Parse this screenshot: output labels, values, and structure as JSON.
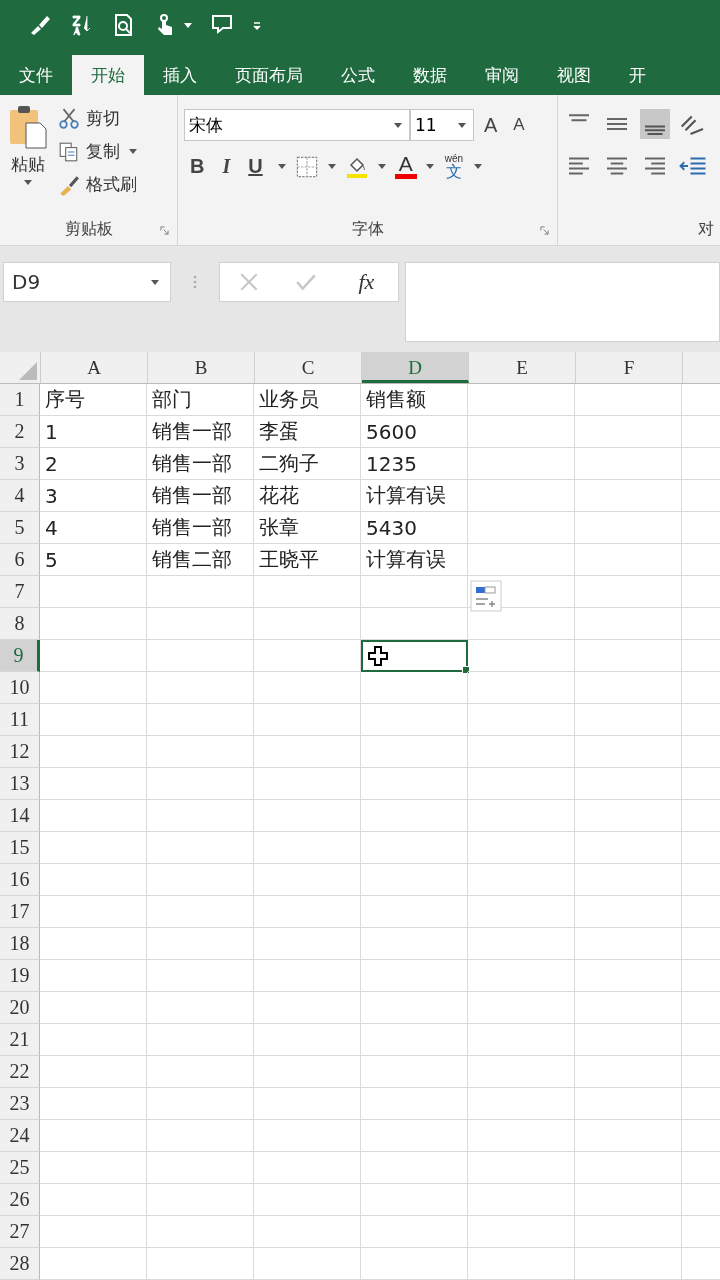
{
  "tabs": [
    {
      "label": "文件",
      "selected": false
    },
    {
      "label": "开始",
      "selected": true
    },
    {
      "label": "插入",
      "selected": false
    },
    {
      "label": "页面布局",
      "selected": false
    },
    {
      "label": "公式",
      "selected": false
    },
    {
      "label": "数据",
      "selected": false
    },
    {
      "label": "审阅",
      "selected": false
    },
    {
      "label": "视图",
      "selected": false
    },
    {
      "label": "开",
      "selected": false
    }
  ],
  "clipboard": {
    "paste": "粘贴",
    "cut": "剪切",
    "copy": "复制",
    "format_painter": "格式刷",
    "label": "剪贴板"
  },
  "font": {
    "name": "宋体",
    "size": "11",
    "grow": "A",
    "shrink": "A",
    "bold": "B",
    "italic": "I",
    "underline": "U",
    "font_color": "A",
    "phonetic_top": "wén",
    "phonetic_bottom": "文",
    "label": "字体"
  },
  "alignment": {
    "label": "对"
  },
  "name_box": "D9",
  "fx": "fx",
  "columns": [
    {
      "label": "A",
      "selected": false
    },
    {
      "label": "B",
      "selected": false
    },
    {
      "label": "C",
      "selected": false
    },
    {
      "label": "D",
      "selected": true
    },
    {
      "label": "E",
      "selected": false
    },
    {
      "label": "F",
      "selected": false
    }
  ],
  "rows": [
    {
      "label": "1",
      "selected": false,
      "cells": [
        "序号",
        "部门",
        "业务员",
        "销售额"
      ]
    },
    {
      "label": "2",
      "selected": false,
      "cells": [
        "1",
        "销售一部",
        "李蛋",
        "5600"
      ]
    },
    {
      "label": "3",
      "selected": false,
      "cells": [
        "2",
        "销售一部",
        "二狗子",
        "1235"
      ]
    },
    {
      "label": "4",
      "selected": false,
      "cells": [
        "3",
        "销售一部",
        "花花",
        "计算有误"
      ]
    },
    {
      "label": "5",
      "selected": false,
      "cells": [
        "4",
        "销售一部",
        "张章",
        "5430"
      ]
    },
    {
      "label": "6",
      "selected": false,
      "cells": [
        "5",
        "销售二部",
        "王晓平",
        "计算有误"
      ]
    },
    {
      "label": "7",
      "selected": false
    },
    {
      "label": "8",
      "selected": false
    },
    {
      "label": "9",
      "selected": true
    },
    {
      "label": "10",
      "selected": false
    },
    {
      "label": "11",
      "selected": false
    },
    {
      "label": "12",
      "selected": false
    },
    {
      "label": "13",
      "selected": false
    },
    {
      "label": "14",
      "selected": false
    },
    {
      "label": "15",
      "selected": false
    },
    {
      "label": "16",
      "selected": false
    },
    {
      "label": "17",
      "selected": false
    },
    {
      "label": "18",
      "selected": false
    },
    {
      "label": "19",
      "selected": false
    },
    {
      "label": "20",
      "selected": false
    },
    {
      "label": "21",
      "selected": false
    },
    {
      "label": "22",
      "selected": false
    },
    {
      "label": "23",
      "selected": false
    },
    {
      "label": "24",
      "selected": false
    },
    {
      "label": "25",
      "selected": false
    },
    {
      "label": "26",
      "selected": false
    },
    {
      "label": "27",
      "selected": false
    },
    {
      "label": "28",
      "selected": false
    }
  ]
}
